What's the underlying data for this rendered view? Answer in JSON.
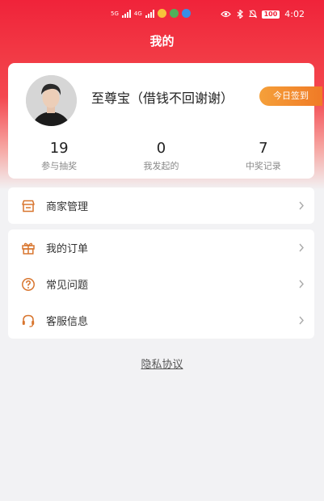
{
  "status_bar": {
    "left_tags": [
      "5G",
      "4G"
    ],
    "battery": "100",
    "time": "4:02"
  },
  "header": {
    "title": "我的"
  },
  "profile": {
    "username": "至尊宝（借钱不回谢谢）",
    "signin_label": "今日签到",
    "stats": [
      {
        "value": "19",
        "label": "参与抽奖"
      },
      {
        "value": "0",
        "label": "我发起的"
      },
      {
        "value": "7",
        "label": "中奖记录"
      }
    ]
  },
  "menu_group1": [
    {
      "label": "商家管理",
      "icon": "store-icon"
    }
  ],
  "menu_group2": [
    {
      "label": "我的订单",
      "icon": "gift-icon"
    },
    {
      "label": "常见问题",
      "icon": "question-icon"
    },
    {
      "label": "客服信息",
      "icon": "headset-icon"
    }
  ],
  "footer": {
    "privacy_label": "隐私协议"
  },
  "colors": {
    "brand": "#f0233a",
    "accent": "#f07a26",
    "icon": "#d8752e"
  }
}
